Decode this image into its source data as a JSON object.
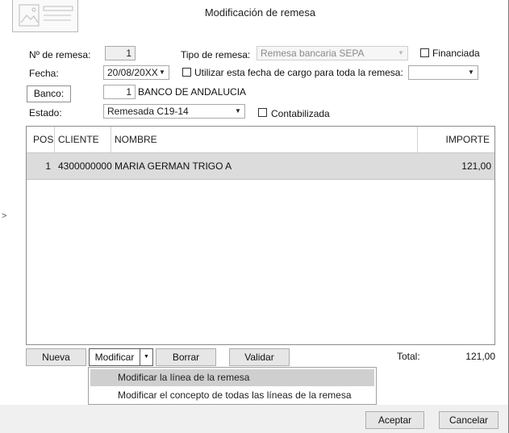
{
  "window": {
    "title": "Modificación de remesa"
  },
  "form": {
    "num_remesa_label": "Nº de remesa:",
    "num_remesa_value": "1",
    "tipo_label": "Tipo de remesa:",
    "tipo_value": "Remesa bancaria SEPA",
    "financiada_label": "Financiada",
    "financiada_checked": false,
    "fecha_label": "Fecha:",
    "fecha_value": "20/08/20XX",
    "utilizar_fecha_label": "Utilizar esta fecha de cargo para toda la remesa:",
    "utilizar_fecha_checked": false,
    "utilizar_fecha_select_value": "",
    "banco_button_label": "Banco:",
    "banco_code": "1",
    "banco_name": "BANCO DE ANDALUCIA",
    "estado_label": "Estado:",
    "estado_value": "Remesada C19-14",
    "contabilizada_label": "Contabilizada",
    "contabilizada_checked": false
  },
  "grid": {
    "columns": {
      "pos": "POS",
      "cliente": "CLIENTE",
      "nombre": "NOMBRE",
      "importe": "IMPORTE"
    },
    "rows": [
      {
        "pos": "1",
        "cliente": "4300000000",
        "nombre": "MARIA GERMAN TRIGO A",
        "importe": "121,00"
      }
    ]
  },
  "actions": {
    "nueva": "Nueva",
    "modificar": "Modificar",
    "borrar": "Borrar",
    "validar": "Validar",
    "total_label": "Total:",
    "total_value": "121,00"
  },
  "modificar_menu": {
    "items": [
      {
        "label": "Modificar la línea de la remesa"
      },
      {
        "label": "Modificar el concepto de todas las líneas de la remesa"
      }
    ]
  },
  "footer": {
    "aceptar": "Aceptar",
    "cancelar": "Cancelar"
  },
  "icons": {
    "logo": "image-document-icon",
    "dropdown": "chevron-down-icon",
    "side": "chevron-right-icon"
  }
}
